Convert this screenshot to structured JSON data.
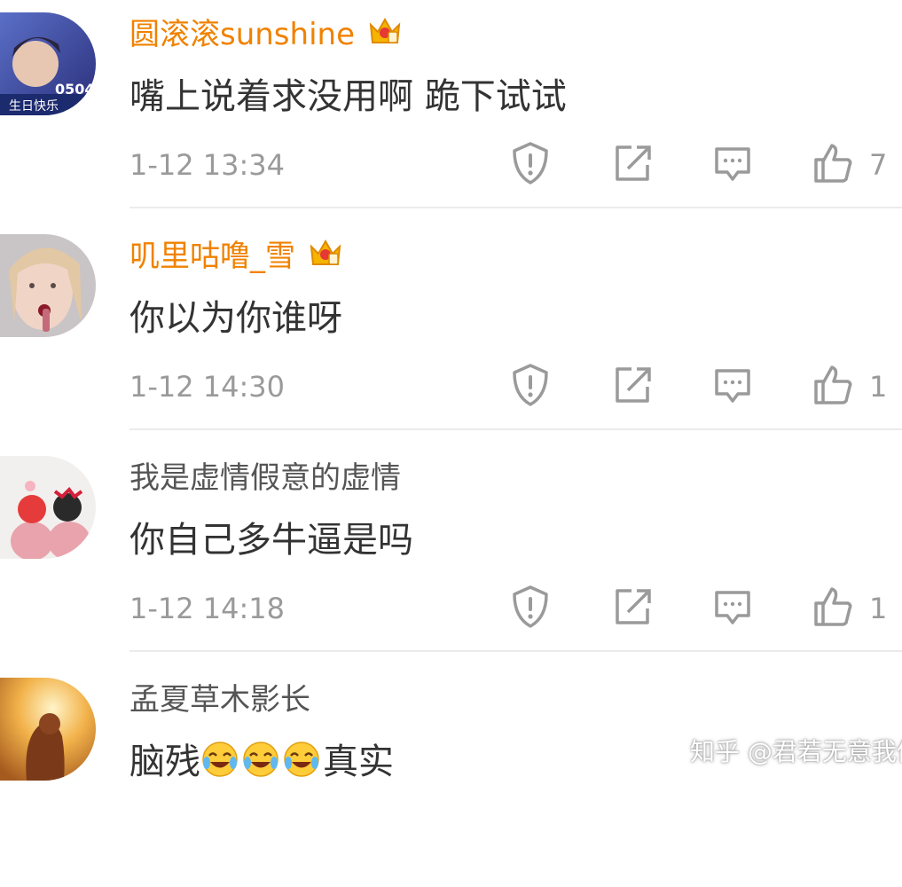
{
  "comments": [
    {
      "user": "圆滚滚sunshine",
      "vip": true,
      "text": "嘴上说着求没用啊 跪下试试",
      "time": "1-12 13:34",
      "likes": "7",
      "avatar_text_1": "0504",
      "avatar_text_2": "生日快乐"
    },
    {
      "user": "叽里咕噜_雪",
      "vip": true,
      "text": "你以为你谁呀",
      "time": "1-12 14:30",
      "likes": "1"
    },
    {
      "user": "我是虚情假意的虚情",
      "vip": false,
      "text": "你自己多牛逼是吗",
      "time": "1-12 14:18",
      "likes": "1"
    },
    {
      "user": "孟夏草木影长",
      "vip": false,
      "text_a": "脑残",
      "emoji": "crying-laughing-emoji",
      "text_b": "真实"
    }
  ],
  "colors": {
    "vip_name": "#f08200",
    "normal_name": "#555555",
    "meta": "#9a9a9a",
    "icon": "#9a9a9a"
  },
  "icons": {
    "report": "alert-shield-icon",
    "forward": "forward-icon",
    "reply": "reply-icon",
    "like": "thumbs-up-icon",
    "vip": "crown-icon"
  },
  "watermark": "知乎 @君若无意我便休"
}
